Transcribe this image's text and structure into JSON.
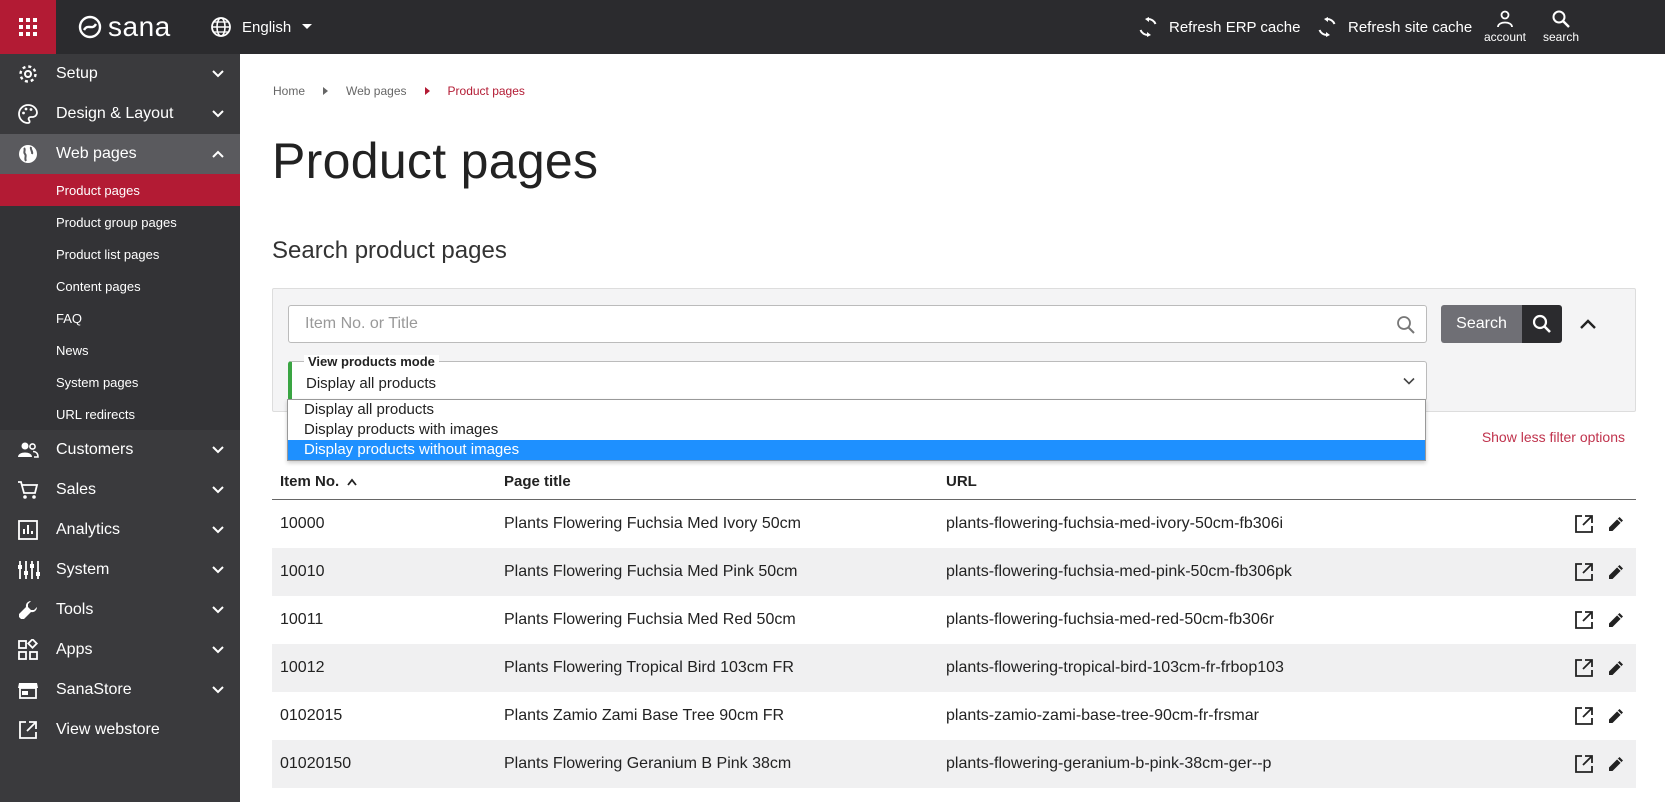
{
  "topbar": {
    "brand": "sana",
    "language": "English",
    "refresh_erp": "Refresh ERP cache",
    "refresh_site": "Refresh site cache",
    "account": "account",
    "search": "search",
    "accent_color": "#b31b34"
  },
  "sidebar": {
    "items": [
      {
        "label": "Setup",
        "icon": "gear-icon"
      },
      {
        "label": "Design & Layout",
        "icon": "palette-icon"
      },
      {
        "label": "Web pages",
        "icon": "globe-icon"
      },
      {
        "label": "Customers",
        "icon": "people-icon"
      },
      {
        "label": "Sales",
        "icon": "cart-icon"
      },
      {
        "label": "Analytics",
        "icon": "chart-icon"
      },
      {
        "label": "System",
        "icon": "sliders-icon"
      },
      {
        "label": "Tools",
        "icon": "wrench-icon"
      },
      {
        "label": "Apps",
        "icon": "apps-icon"
      },
      {
        "label": "SanaStore",
        "icon": "store-icon"
      },
      {
        "label": "View webstore",
        "icon": "external-link-icon"
      }
    ],
    "web_pages_sub": [
      "Product pages",
      "Product group pages",
      "Product list pages",
      "Content pages",
      "FAQ",
      "News",
      "System pages",
      "URL redirects"
    ]
  },
  "breadcrumb": [
    "Home",
    "Web pages",
    "Product pages"
  ],
  "page": {
    "title": "Product pages",
    "section_title": "Search product pages"
  },
  "filter": {
    "search_placeholder": "Item No. or Title",
    "search_button": "Search",
    "mode_label": "View products mode",
    "mode_value": "Display all products",
    "options": [
      "Display all products",
      "Display products with images",
      "Display products without images"
    ],
    "highlighted_option": 2,
    "less_filter": "Show less filter options"
  },
  "table": {
    "headers": [
      "Item No.",
      "Page title",
      "URL"
    ],
    "rows": [
      {
        "item": "10000",
        "title": "Plants Flowering Fuchsia Med Ivory 50cm",
        "url": "plants-flowering-fuchsia-med-ivory-50cm-fb306i"
      },
      {
        "item": "10010",
        "title": "Plants Flowering Fuchsia Med Pink 50cm",
        "url": "plants-flowering-fuchsia-med-pink-50cm-fb306pk"
      },
      {
        "item": "10011",
        "title": "Plants Flowering Fuchsia Med Red 50cm",
        "url": "plants-flowering-fuchsia-med-red-50cm-fb306r"
      },
      {
        "item": "10012",
        "title": "Plants Flowering Tropical Bird 103cm FR",
        "url": "plants-flowering-tropical-bird-103cm-fr-frbop103"
      },
      {
        "item": "0102015",
        "title": "Plants Zamio Zami Base Tree 90cm FR",
        "url": "plants-zamio-zami-base-tree-90cm-fr-frsmar"
      },
      {
        "item": "01020150",
        "title": "Plants Flowering Geranium B Pink 38cm",
        "url": "plants-flowering-geranium-b-pink-38cm-ger--p"
      }
    ]
  }
}
